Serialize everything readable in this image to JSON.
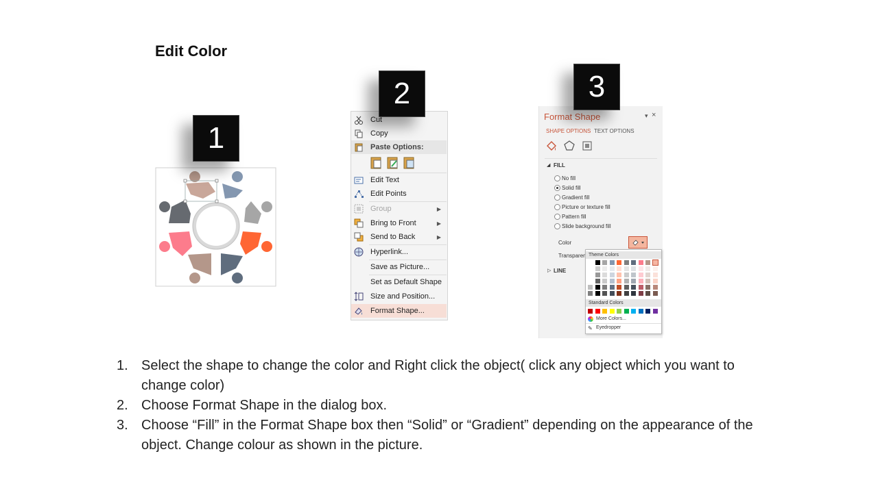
{
  "title": "Edit Color",
  "badges": [
    "1",
    "2",
    "3"
  ],
  "context_menu": {
    "items": [
      {
        "label": "Cut",
        "icon": "scissors-icon",
        "state": "normal"
      },
      {
        "label": "Copy",
        "icon": "copy-icon",
        "state": "normal"
      },
      {
        "label": "Paste Options:",
        "icon": "paste-icon",
        "state": "header"
      },
      {
        "label": "Edit Text",
        "icon": "edit-text-icon",
        "state": "normal"
      },
      {
        "label": "Edit Points",
        "icon": "edit-points-icon",
        "state": "normal"
      },
      {
        "label": "Group",
        "icon": "group-icon",
        "state": "disabled",
        "submenu": true
      },
      {
        "label": "Bring to Front",
        "icon": "bring-to-front-icon",
        "state": "normal",
        "submenu": true
      },
      {
        "label": "Send to Back",
        "icon": "send-to-back-icon",
        "state": "normal",
        "submenu": true
      },
      {
        "label": "Hyperlink...",
        "icon": "hyperlink-icon",
        "state": "normal"
      },
      {
        "label": "Save as Picture...",
        "icon": "",
        "state": "normal"
      },
      {
        "label": "Set as Default Shape",
        "icon": "",
        "state": "normal"
      },
      {
        "label": "Size and Position...",
        "icon": "size-position-icon",
        "state": "normal"
      },
      {
        "label": "Format Shape...",
        "icon": "format-shape-icon",
        "state": "highlighted"
      }
    ]
  },
  "format_pane": {
    "title": "Format Shape",
    "tabs": [
      "SHAPE OPTIONS",
      "TEXT OPTIONS"
    ],
    "fill_section": "FILL",
    "fill_options": [
      {
        "label": "No fill",
        "selected": false
      },
      {
        "label": "Solid fill",
        "selected": true
      },
      {
        "label": "Gradient fill",
        "selected": false
      },
      {
        "label": "Picture or texture fill",
        "selected": false
      },
      {
        "label": "Pattern fill",
        "selected": false
      },
      {
        "label": "Slide background fill",
        "selected": false
      }
    ],
    "color_label": "Color",
    "transparency_label": "Transparenc",
    "line_section": "LINE",
    "popup": {
      "theme_label": "Theme Colors",
      "standard_label": "Standard Colors",
      "more_colors": "More Colors...",
      "eyedropper": "Eyedropper",
      "theme_top": [
        "#ffffff",
        "#000000",
        "#a6a6a6",
        "#8497b0",
        "#ff6633",
        "#7f7f7f",
        "#5f6d7e",
        "#fc7c8c",
        "#b4978a",
        "#f6b5a2"
      ],
      "standard": [
        "#c00000",
        "#ff0000",
        "#ffc000",
        "#ffff00",
        "#92d050",
        "#00b050",
        "#00b0f0",
        "#0070c0",
        "#002060",
        "#7030a0"
      ]
    }
  },
  "steps": [
    {
      "n": "1.",
      "text": "Select the shape to change the color and Right click the object( click any object which you want to change color)"
    },
    {
      "n": "2.",
      "text": "Choose Format Shape in the dialog box."
    },
    {
      "n": "3.",
      "text": "Choose “Fill” in the Format Shape box then “Solid” or “Gradient” depending on the appearance of the object. Change colour as shown in the picture."
    }
  ]
}
